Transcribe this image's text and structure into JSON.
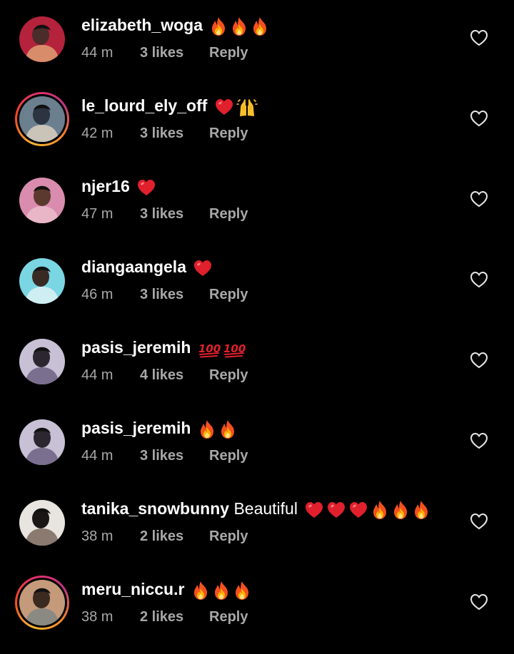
{
  "comments": [
    {
      "username": "elizabeth_woga",
      "text": "",
      "emojis": [
        "fire",
        "fire",
        "fire"
      ],
      "time": "44 m",
      "likes": "3 likes",
      "reply": "Reply",
      "story_ring": false,
      "avatar_colors": [
        "#b5223c",
        "#4a2c2a",
        "#d98c6a"
      ]
    },
    {
      "username": "le_lourd_ely_off",
      "text": "",
      "emojis": [
        "red-heart",
        "raised-hands"
      ],
      "time": "42 m",
      "likes": "3 likes",
      "reply": "Reply",
      "story_ring": true,
      "avatar_colors": [
        "#6b7f8f",
        "#2b3440",
        "#c9c3b8"
      ]
    },
    {
      "username": "njer16",
      "text": "",
      "emojis": [
        "red-heart"
      ],
      "time": "47 m",
      "likes": "3 likes",
      "reply": "Reply",
      "story_ring": false,
      "avatar_colors": [
        "#d98cae",
        "#5a3a2c",
        "#e9b6c8"
      ]
    },
    {
      "username": "diangaangela",
      "text": "",
      "emojis": [
        "red-heart"
      ],
      "time": "46 m",
      "likes": "3 likes",
      "reply": "Reply",
      "story_ring": false,
      "avatar_colors": [
        "#7ad6e2",
        "#3a2a24",
        "#cfeef2"
      ]
    },
    {
      "username": "pasis_jeremih",
      "text": "",
      "emojis": [
        "hundred",
        "hundred"
      ],
      "time": "44 m",
      "likes": "4 likes",
      "reply": "Reply",
      "story_ring": false,
      "avatar_colors": [
        "#c8c0d4",
        "#2c2630",
        "#7a6f8e"
      ]
    },
    {
      "username": "pasis_jeremih",
      "text": "",
      "emojis": [
        "fire",
        "fire"
      ],
      "time": "44 m",
      "likes": "3 likes",
      "reply": "Reply",
      "story_ring": false,
      "avatar_colors": [
        "#c8c0d4",
        "#2c2630",
        "#7a6f8e"
      ]
    },
    {
      "username": "tanika_snowbunny",
      "text": "Beautiful",
      "emojis": [
        "red-heart",
        "red-heart",
        "red-heart",
        "fire",
        "fire",
        "fire"
      ],
      "time": "38 m",
      "likes": "2 likes",
      "reply": "Reply",
      "story_ring": false,
      "avatar_colors": [
        "#e8e4e0",
        "#1a1616",
        "#8a7a70"
      ]
    },
    {
      "username": "meru_niccu.r",
      "text": "",
      "emojis": [
        "fire",
        "fire",
        "fire"
      ],
      "time": "38 m",
      "likes": "2 likes",
      "reply": "Reply",
      "story_ring": true,
      "avatar_colors": [
        "#c49a7a",
        "#3a2a20",
        "#8a8a82"
      ]
    }
  ]
}
